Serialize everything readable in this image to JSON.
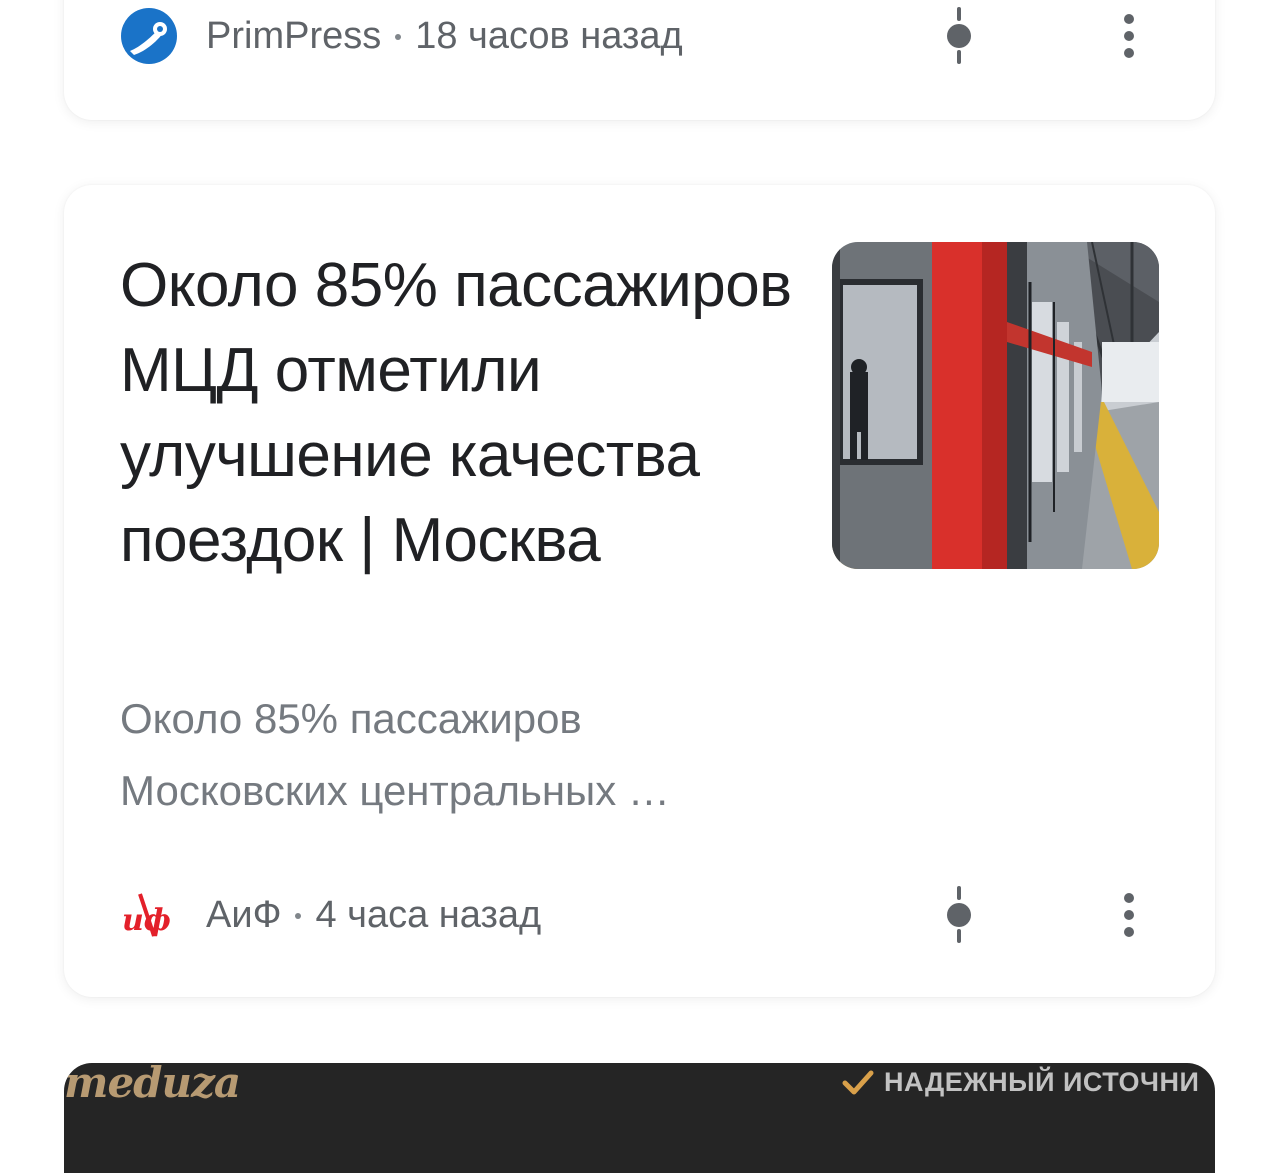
{
  "top_card": {
    "source": "PrimPress",
    "time": "18 часов назад",
    "source_logo_color": "#1a73c8"
  },
  "main_card": {
    "title": "Около 85% пассажиров МЦД отметили улучшение качества поездок | Москва",
    "snippet": "Около 85% пассажиров Московских центральных …",
    "source": "АиФ",
    "time": "4 часа назад",
    "thumbnail_icon": "train-platform-photo",
    "source_logo_color": "#e3202a"
  },
  "bottom_card": {
    "source_logo": "meduza",
    "badge": "НАДЕЖНЫЙ ИСТОЧНИ",
    "logo_color": "#b79a72",
    "badge_check_color": "#d9a04a"
  },
  "icons": {
    "pin": "pin-icon",
    "more": "more-vert-icon"
  }
}
